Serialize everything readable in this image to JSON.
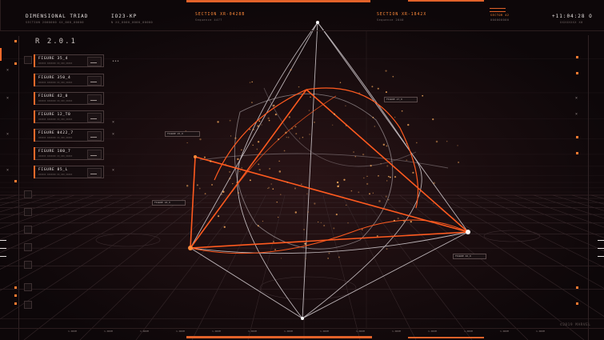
{
  "header": {
    "title": "DIMENSIONAL TRIAD",
    "title_sub": "SECTION 2000000 XX_000_00000",
    "code": "IO23-KP",
    "code_sub": "N XX_0000_0000_00000",
    "section_a": "SECTION XR-0428B",
    "section_a_sub": "Sequence 4477",
    "section_b": "SECTION XR-1842X",
    "section_b_sub": "Sequence 2040",
    "right_label": "SECTOR 42",
    "right_label_sub": "000000000",
    "clock": "+11:04:28 O",
    "clock_sub": "XXXXXXXX X0"
  },
  "left_panel": {
    "title": "R 2.0.1",
    "items": [
      {
        "label": "FIGURE 35_4",
        "sub": "XXXXXX XXXXXXX XX_XXX_XXXXX"
      },
      {
        "label": "FIGURE 350_4",
        "sub": "XXXXXX XXXXXXX XX_XXX_XXXXX"
      },
      {
        "label": "FIGURE 42_0",
        "sub": "XXXXXX XXXXXXX XX_XXX_XXXXX"
      },
      {
        "label": "FIGURE 12_T0",
        "sub": "XXXXXX XXXXXXX XX_XXX_XXXXX"
      },
      {
        "label": "FIGURE 0422_7",
        "sub": "XXXXXX XXXXXXX XX_XXX_XXXXX"
      },
      {
        "label": "FIGURE 180_7",
        "sub": "XXXXXX XXXXXXX XX_XXX_XXXXX"
      },
      {
        "label": "FIGURE 85_L",
        "sub": "XXXXXX XXXXXXX XX_XXX_XXXXX"
      }
    ]
  },
  "tags": [
    "FIGURE 25_0",
    "FIGURE 18_0",
    "FIGURE 27_0",
    "FIGURE 46_0"
  ],
  "footer_ticks": [
    "1.000M",
    "1.000M",
    "1.000M",
    "1.000M",
    "1.000M",
    "1.000M",
    "1.000M",
    "1.000M",
    "1.000M",
    "1.000M",
    "1.000M",
    "1.000M",
    "1.000M",
    "1.000M"
  ],
  "copyright": "©2019 MARVEL",
  "colors": {
    "accent": "#ff6a2a",
    "line": "#d9d2d6",
    "bg": "#0d0709"
  },
  "icons": [
    "close-icon",
    "menu-icon",
    "x-mark-icon"
  ]
}
